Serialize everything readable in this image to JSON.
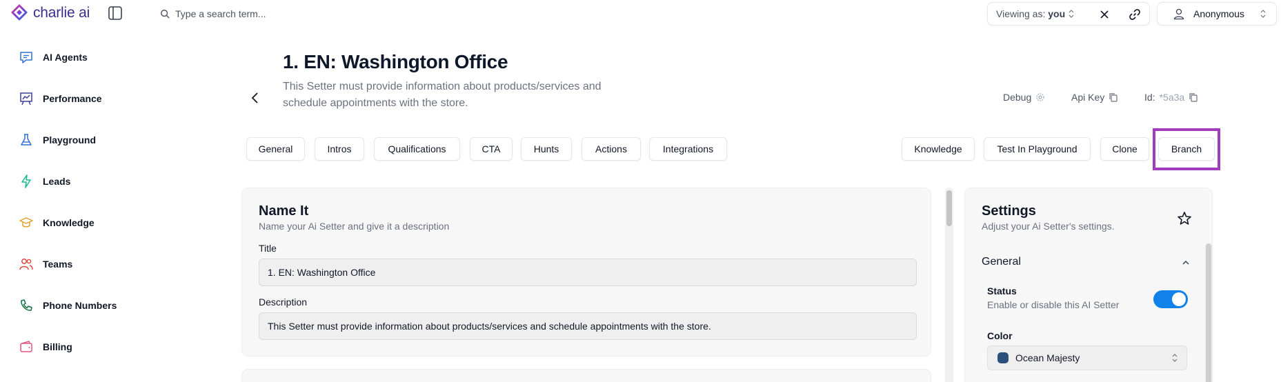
{
  "brand": {
    "name": "charlie ai",
    "color": "#3b2d8f"
  },
  "search": {
    "placeholder": "Type a search term..."
  },
  "viewing": {
    "prefix": "Viewing as:",
    "value": "you"
  },
  "user": {
    "name": "Anonymous"
  },
  "sidebar": {
    "items": [
      {
        "label": "AI Agents",
        "icon": "chat-bubble-icon",
        "color": "#2f6fd8"
      },
      {
        "label": "Performance",
        "icon": "chart-board-icon",
        "color": "#3b3f9e"
      },
      {
        "label": "Playground",
        "icon": "flask-icon",
        "color": "#2f6fd8"
      },
      {
        "label": "Leads",
        "icon": "lightning-icon",
        "color": "#14b88a"
      },
      {
        "label": "Knowledge",
        "icon": "graduation-cap-icon",
        "color": "#e0a22b"
      },
      {
        "label": "Teams",
        "icon": "users-icon",
        "color": "#e0443c"
      },
      {
        "label": "Phone Numbers",
        "icon": "phone-icon",
        "color": "#12703f"
      },
      {
        "label": "Billing",
        "icon": "wallet-icon",
        "color": "#e0557b"
      }
    ]
  },
  "header": {
    "title": "1. EN: Washington Office",
    "description": "This Setter must provide information about products/services and schedule appointments with the store.",
    "debug_label": "Debug",
    "apikey_label": "Api Key",
    "id_label": "Id:",
    "id_value": "*5a3a"
  },
  "tabs": [
    "General",
    "Intros",
    "Qualifications",
    "CTA",
    "Hunts",
    "Actions",
    "Integrations"
  ],
  "actions": [
    "Knowledge",
    "Test In Playground",
    "Clone",
    "Branch"
  ],
  "name_card": {
    "title": "Name It",
    "subtitle": "Name your Ai Setter and give it a description",
    "title_label": "Title",
    "title_value": "1. EN: Washington Office",
    "description_label": "Description",
    "description_value": "This Setter must provide information about products/services and schedule appointments with the store."
  },
  "settings": {
    "title": "Settings",
    "subtitle": "Adjust your Ai Setter's settings.",
    "section": "General",
    "status_label": "Status",
    "status_sub": "Enable or disable this AI Setter",
    "status_enabled": true,
    "color_label": "Color",
    "color_value": "Ocean Majesty",
    "color_swatch": "#2c4f7c",
    "toggle_color": "#1281e9"
  },
  "highlight_color": "#a33bbf"
}
